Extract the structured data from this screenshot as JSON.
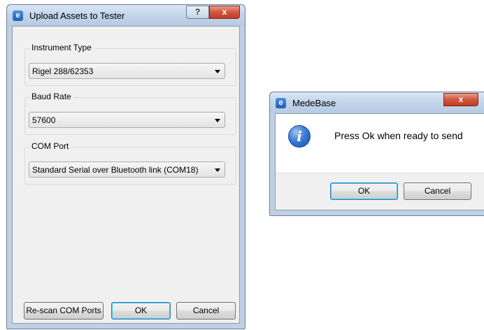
{
  "upload_dialog": {
    "title": "Upload Assets to Tester",
    "icon": "app-e-icon",
    "help_glyph": "?",
    "close_glyph": "x",
    "groups": [
      {
        "label": "Instrument Type",
        "value": "Rigel 288/62353"
      },
      {
        "label": "Baud Rate",
        "value": "57600"
      },
      {
        "label": "COM Port",
        "value": "Standard Serial over Bluetooth link (COM18)"
      }
    ],
    "buttons": {
      "rescan": "Re-scan COM Ports",
      "ok": "OK",
      "cancel": "Cancel"
    }
  },
  "message_box": {
    "title": "MedeBase",
    "icon": "information-icon",
    "icon_glyph": "i",
    "message": "Press Ok when ready to send",
    "close_glyph": "x",
    "buttons": {
      "ok": "OK",
      "cancel": "Cancel"
    }
  },
  "colors": {
    "title_bar": "#c2d4ea",
    "close_button": "#c23b23",
    "default_button_border": "#3c7fb1",
    "info_icon": "#3c7dd6"
  }
}
